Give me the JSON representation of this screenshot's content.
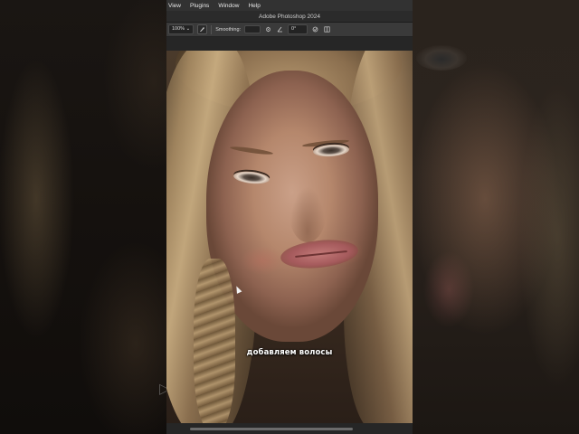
{
  "menubar": {
    "items": [
      "View",
      "Plugins",
      "Window",
      "Help"
    ]
  },
  "window": {
    "title": "Adobe Photoshop 2024"
  },
  "options_bar": {
    "zoom_value": "100%",
    "zoom_arrow": "⌄",
    "smoothing_label": "Smoothing:",
    "angle_value": "0°",
    "icons": [
      "brush-settings-icon",
      "gear-icon",
      "angle-icon",
      "pressure-icon",
      "symmetry-icon"
    ]
  },
  "canvas": {
    "caption": "добавляем волосы"
  }
}
